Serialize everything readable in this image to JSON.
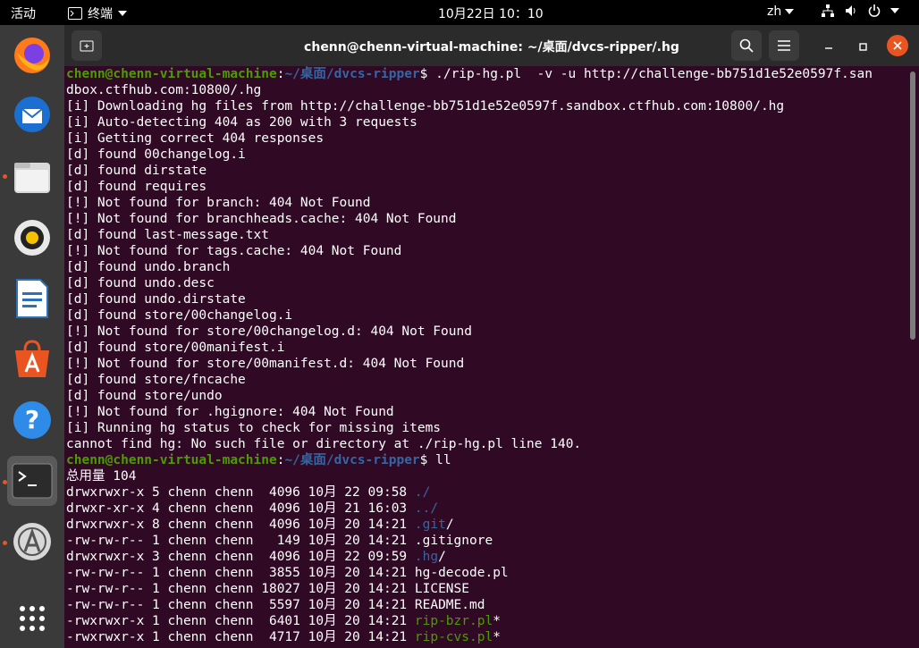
{
  "topbar": {
    "activities": "活动",
    "app": "终端",
    "clock": "10月22日  10：10",
    "lang": "zh"
  },
  "window": {
    "title": "chenn@chenn-virtual-machine: ~/桌面/dvcs-ripper/.hg"
  },
  "prompt": {
    "user": "chenn@chenn-virtual-machine",
    "path": "~/桌面/dvcs-ripper"
  },
  "lines": {
    "cmd1a": "$ ./rip-hg.pl  -v -u http://challenge-bb751d1e52e0597f.san",
    "cmd1b": "dbox.ctfhub.com:10800/.hg",
    "o1": "[i] Downloading hg files from http://challenge-bb751d1e52e0597f.sandbox.ctfhub.com:10800/.hg",
    "o2": "[i] Auto-detecting 404 as 200 with 3 requests",
    "o3": "[i] Getting correct 404 responses",
    "o4": "[d] found 00changelog.i",
    "o5": "[d] found dirstate",
    "o6": "[d] found requires",
    "o7": "[!] Not found for branch: 404 Not Found",
    "o8": "[!] Not found for branchheads.cache: 404 Not Found",
    "o9": "[d] found last-message.txt",
    "o10": "[!] Not found for tags.cache: 404 Not Found",
    "o11": "[d] found undo.branch",
    "o12": "[d] found undo.desc",
    "o13": "[d] found undo.dirstate",
    "o14": "[d] found store/00changelog.i",
    "o15": "[!] Not found for store/00changelog.d: 404 Not Found",
    "o16": "[d] found store/00manifest.i",
    "o17": "[!] Not found for store/00manifest.d: 404 Not Found",
    "o18": "[d] found store/fncache",
    "o19": "[d] found store/undo",
    "o20": "[!] Not found for .hgignore: 404 Not Found",
    "o21": "[i] Running hg status to check for missing items",
    "o22": "cannot find hg: No such file or directory at ./rip-hg.pl line 140.",
    "cmd2": "$ ll",
    "total": "总用量 104"
  },
  "listing": [
    {
      "meta": "drwxrwxr-x 5 chenn chenn  4096 10月 22 09:58 ",
      "name": "./",
      "kind": "dir"
    },
    {
      "meta": "drwxr-xr-x 4 chenn chenn  4096 10月 21 16:03 ",
      "name": "../",
      "kind": "dir"
    },
    {
      "meta": "drwxrwxr-x 8 chenn chenn  4096 10月 20 14:21 ",
      "name": ".git",
      "suffix": "/",
      "kind": "dir"
    },
    {
      "meta": "-rw-rw-r-- 1 chenn chenn   149 10月 20 14:21 ",
      "name": ".gitignore",
      "kind": "file"
    },
    {
      "meta": "drwxrwxr-x 3 chenn chenn  4096 10月 22 09:59 ",
      "name": ".hg",
      "suffix": "/",
      "kind": "dir"
    },
    {
      "meta": "-rw-rw-r-- 1 chenn chenn  3855 10月 20 14:21 ",
      "name": "hg-decode.pl",
      "kind": "file"
    },
    {
      "meta": "-rw-rw-r-- 1 chenn chenn 18027 10月 20 14:21 ",
      "name": "LICENSE",
      "kind": "file"
    },
    {
      "meta": "-rw-rw-r-- 1 chenn chenn  5597 10月 20 14:21 ",
      "name": "README.md",
      "kind": "file"
    },
    {
      "meta": "-rwxrwxr-x 1 chenn chenn  6401 10月 20 14:21 ",
      "name": "rip-bzr.pl",
      "suffix": "*",
      "kind": "exec"
    },
    {
      "meta": "-rwxrwxr-x 1 chenn chenn  4717 10月 20 14:21 ",
      "name": "rip-cvs.pl",
      "suffix": "*",
      "kind": "exec"
    }
  ],
  "dock": [
    "firefox-icon",
    "thunderbird-icon",
    "files-icon",
    "rhythmbox-icon",
    "writer-icon",
    "software-icon",
    "help-icon",
    "terminal-icon",
    "updater-icon",
    "apps-grid-icon"
  ]
}
